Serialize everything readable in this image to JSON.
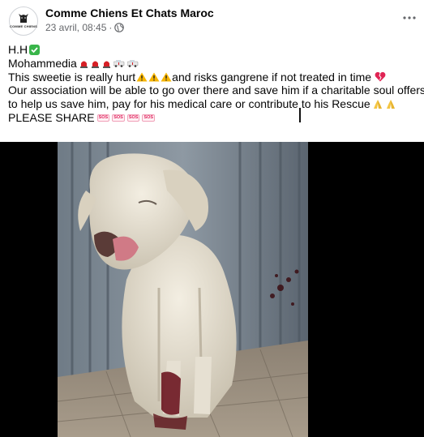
{
  "post": {
    "page_name": "Comme Chiens Et Chats Maroc",
    "avatar_text": "COMME CHIENS",
    "date": "23 avril, 08:45",
    "separator": "·",
    "privacy_icon": "globe-icon",
    "more_icon": "more-horizontal-icon",
    "text": {
      "line1": "H.H",
      "line2": "Mohammedia",
      "line3_a": "This sweetie is really hurt",
      "line3_b": " and risks gangrene if not treated in time",
      "line4": "Our association will be able to go over there and save him if a charitable soul offers",
      "line5": "to help us save him, pay for his medical care or contribute to his Rescue",
      "line6": "PLEASE SHARE",
      "sos_label": "SOS"
    }
  },
  "colors": {
    "text": "#050505",
    "meta": "#65676b",
    "check": "#39b54a",
    "warning": "#f7b500",
    "heart": "#e02454",
    "media_bg": "#000000"
  }
}
